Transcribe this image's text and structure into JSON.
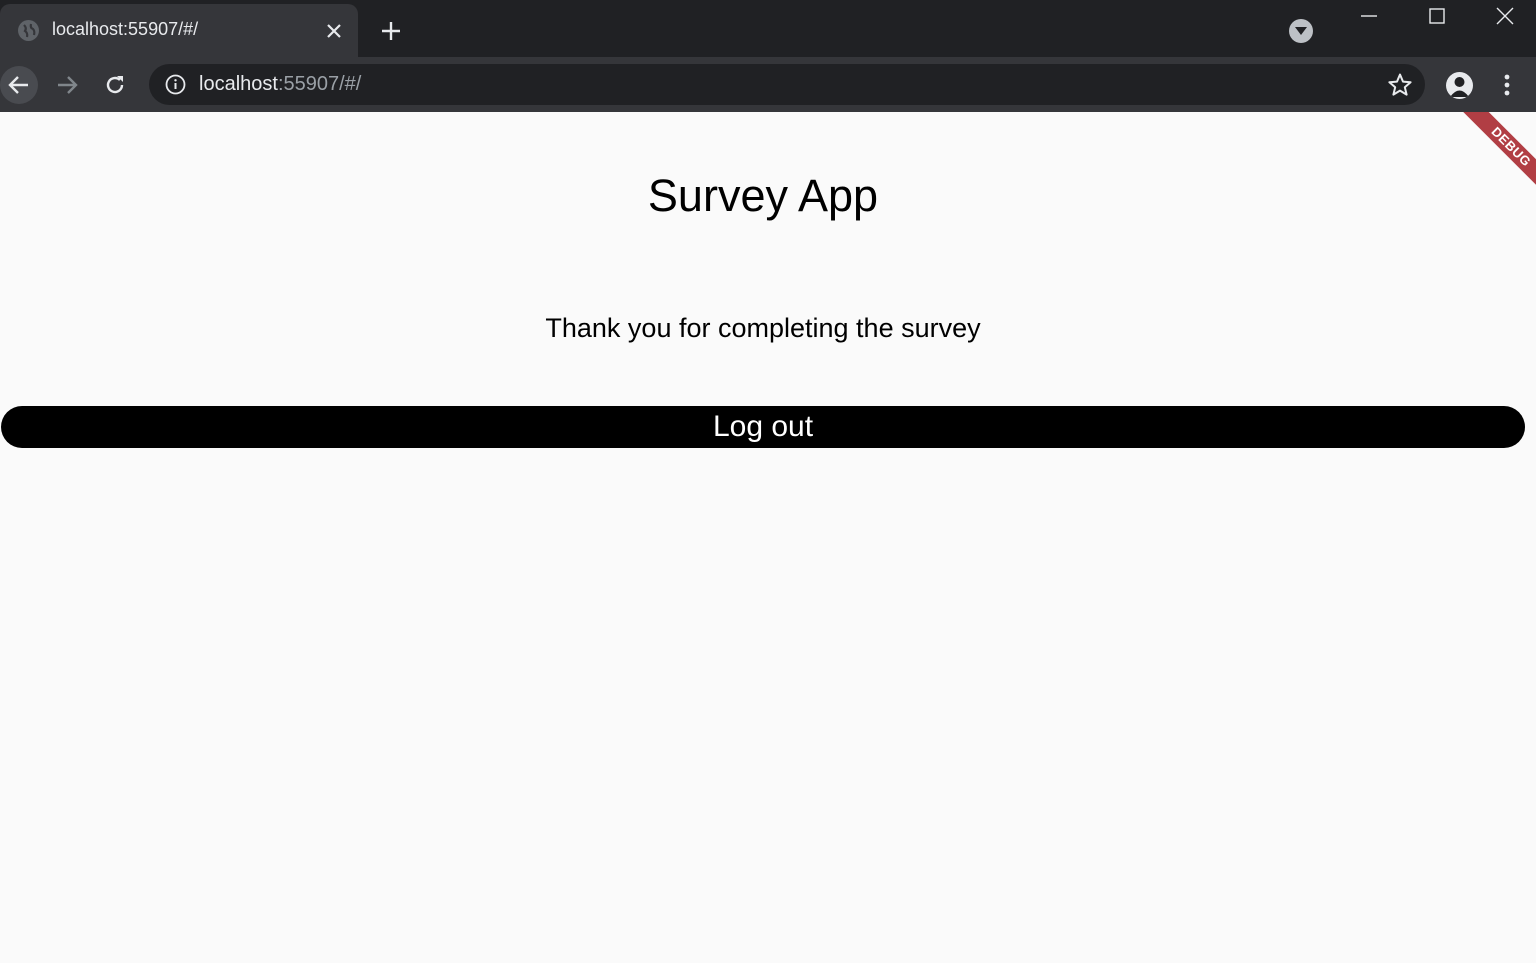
{
  "browser": {
    "tab": {
      "title": "localhost:55907/#/",
      "favicon": "globe-icon"
    },
    "address": {
      "host": "localhost",
      "rest": ":55907/#/"
    },
    "icons": {
      "back": "arrow-left-icon",
      "forward": "arrow-right-icon",
      "reload": "reload-icon",
      "info": "info-icon",
      "bookmark": "star-icon",
      "profile": "profile-icon",
      "menu": "more-vert-icon"
    },
    "colors": {
      "frame": "#202124",
      "toolbar": "#35363a"
    }
  },
  "app": {
    "title": "Survey App",
    "message": "Thank you for completing the survey",
    "logout_label": "Log out",
    "debug_banner": "DEBUG",
    "colors": {
      "background": "#fafafa",
      "button": "#000000",
      "button_text": "#ffffff",
      "debug_banner": "#b13e44"
    }
  }
}
